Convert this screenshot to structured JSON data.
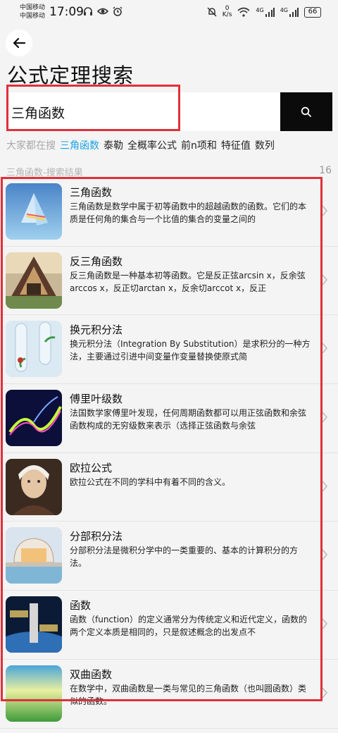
{
  "status_bar": {
    "carrier_1": "中国移动",
    "carrier_2": "中国移动",
    "time": "17:09",
    "net_speed_value": "0",
    "net_speed_unit": "K/s",
    "sig_1": "4G",
    "sig_2": "4G",
    "battery": "66"
  },
  "header": {
    "title": "公式定理搜索"
  },
  "search": {
    "value": "三角函数"
  },
  "hot": {
    "label": "大家都在搜",
    "tags": [
      "三角函数",
      "泰勒",
      "全概率公式",
      "前n项和",
      "特征值",
      "数列"
    ]
  },
  "results": {
    "heading": "三角函数-搜索结果",
    "count": "16",
    "items": [
      {
        "title": "三角函数",
        "desc": "三角函数是数学中属于初等函数中的超越函数的函数。它们的本质是任何角的集合与一个比值的集合的变量之间的",
        "icon": "prism-thumbnail"
      },
      {
        "title": "反三角函数",
        "desc": "反三角函数是一种基本初等函数。它是反正弦arcsin x，反余弦arccos x，反正切arctan x，反余切arccot x，反正",
        "icon": "a-frame-house-thumbnail"
      },
      {
        "title": "换元积分法",
        "desc": "换元积分法（Integration By Substitution）是求积分的一种方法，主要通过引进中间变量作变量替换使原式简",
        "icon": "test-tube-sprout-thumbnail"
      },
      {
        "title": "傅里叶级数",
        "desc": "法国数学家傅里叶发现，任何周期函数都可以用正弦函数和余弦函数构成的无穷级数来表示（选择正弦函数与余弦",
        "icon": "light-wave-thumbnail"
      },
      {
        "title": "欧拉公式",
        "desc": "欧拉公式在不同的学科中有着不同的含义。",
        "icon": "euler-portrait-thumbnail"
      },
      {
        "title": "分部积分法",
        "desc": "分部积分法是微积分学中的一类重要的、基本的计算积分的方法。",
        "icon": "modern-house-thumbnail"
      },
      {
        "title": "函数",
        "desc": "函数（function）的定义通常分为传统定义和近代定义，函数的两个定义本质是相同的，只是叙述概念的出发点不",
        "icon": "space-station-thumbnail"
      },
      {
        "title": "双曲函数",
        "desc": "在数学中，双曲函数是一类与常见的三角函数（也叫圆函数）类似的函数。",
        "icon": "green-field-thumbnail"
      }
    ]
  },
  "colors": {
    "highlight": "#e0303a",
    "accent": "#1aa3e8",
    "search_button": "#0b0b0b"
  }
}
